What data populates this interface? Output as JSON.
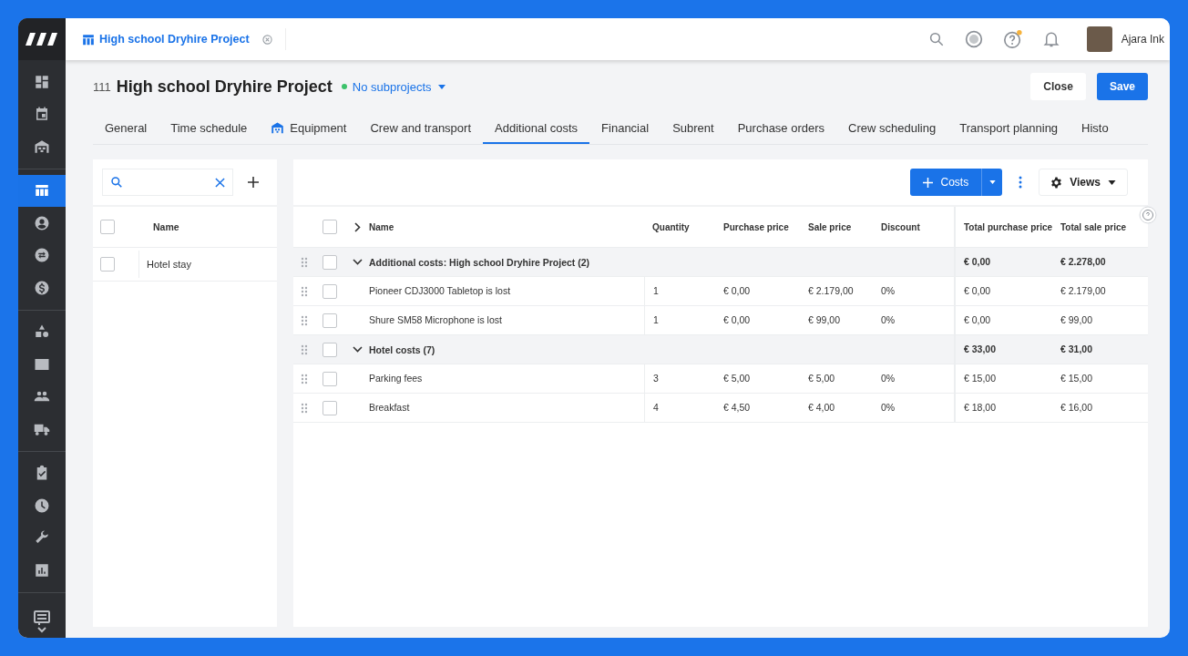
{
  "top_bar": {
    "project_tab": "High school Dryhire Project",
    "user_name": "Ajara Ink"
  },
  "sidebar": {
    "sections": [
      {
        "items": [
          {
            "selected": false
          },
          {
            "selected": false
          },
          {
            "selected": false
          }
        ]
      },
      {
        "items": [
          {
            "selected": true
          },
          {
            "selected": false
          },
          {
            "selected": false
          },
          {
            "selected": false
          }
        ]
      },
      {
        "items": [
          {
            "selected": false
          },
          {
            "selected": false
          },
          {
            "selected": false
          },
          {
            "selected": false
          }
        ]
      },
      {
        "items": [
          {
            "selected": false
          },
          {
            "selected": false
          },
          {
            "selected": false
          },
          {
            "selected": false
          }
        ]
      }
    ]
  },
  "header": {
    "number": "111",
    "title": "High school Dryhire Project",
    "status_dot": {
      "color": "#3cc26b"
    },
    "subprojects": "No subprojects",
    "buttons": [
      "Close",
      "Save"
    ]
  },
  "tabs": [
    {
      "label": "General",
      "kind": "plain",
      "selected": false
    },
    {
      "label": "Time schedule",
      "kind": "plain",
      "selected": false
    },
    {
      "label": "Equipment",
      "kind": "with_icon",
      "selected": false
    },
    {
      "label": "Crew and transport",
      "kind": "plain",
      "selected": false
    },
    {
      "label": "Additional costs",
      "kind": "plain",
      "selected": true
    },
    {
      "label": "Financial",
      "kind": "plain",
      "selected": false
    },
    {
      "label": "Subrent",
      "kind": "plain",
      "selected": false
    },
    {
      "label": "Purchase orders",
      "kind": "plain",
      "selected": false
    },
    {
      "label": "Crew scheduling",
      "kind": "plain",
      "selected": false
    },
    {
      "label": "Transport planning",
      "kind": "plain",
      "selected": false
    },
    {
      "label": "Histo",
      "kind": "plain",
      "selected": false
    }
  ],
  "left_panel": {
    "column": "Name",
    "all_checked": false,
    "rows": [
      {
        "name": "Hotel stay",
        "checked": false
      }
    ]
  },
  "toolbar": {
    "add_button": "Costs",
    "views_button": "Views"
  },
  "table": {
    "all_checked": false,
    "columns": [
      "Name",
      "Quantity",
      "Purchase price",
      "Sale price",
      "Discount",
      "Total purchase price",
      "Total sale price"
    ],
    "rows": [
      {
        "kind": "group",
        "expanded": true,
        "checked": false,
        "name": "Additional costs: High school Dryhire Project (2)",
        "total_purchase": "€ 0,00",
        "total_sale": "€ 2.278,00"
      },
      {
        "kind": "item",
        "checked": false,
        "name": "Pioneer CDJ3000 Tabletop is lost",
        "quantity": "1",
        "purchase_price": "€ 0,00",
        "sale_price": "€ 2.179,00",
        "discount": "0%",
        "total_purchase": "€ 0,00",
        "total_sale": "€ 2.179,00"
      },
      {
        "kind": "item",
        "checked": false,
        "name": "Shure SM58 Microphone is lost",
        "quantity": "1",
        "purchase_price": "€ 0,00",
        "sale_price": "€ 99,00",
        "discount": "0%",
        "total_purchase": "€ 0,00",
        "total_sale": "€ 99,00"
      },
      {
        "kind": "group",
        "expanded": true,
        "checked": false,
        "name": "Hotel costs (7)",
        "total_purchase": "€ 33,00",
        "total_sale": "€ 31,00"
      },
      {
        "kind": "item",
        "checked": false,
        "name": "Parking fees",
        "quantity": "3",
        "purchase_price": "€ 5,00",
        "sale_price": "€ 5,00",
        "discount": "0%",
        "total_purchase": "€ 15,00",
        "total_sale": "€ 15,00"
      },
      {
        "kind": "item",
        "checked": false,
        "name": "Breakfast",
        "quantity": "4",
        "purchase_price": "€ 4,50",
        "sale_price": "€ 4,00",
        "discount": "0%",
        "total_purchase": "€ 18,00",
        "total_sale": "€ 16,00"
      }
    ]
  }
}
